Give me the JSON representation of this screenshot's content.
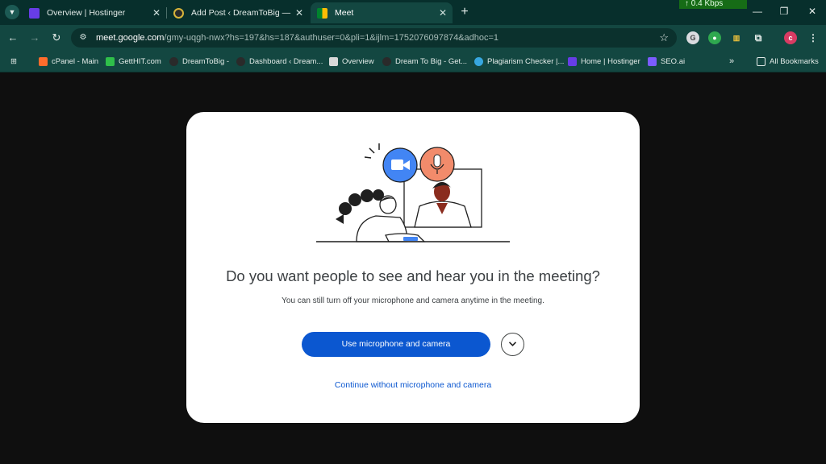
{
  "browser": {
    "tabs": [
      {
        "title": "Overview | Hostinger",
        "favicon": "hostinger-icon",
        "active": false
      },
      {
        "title": "Add Post ‹ DreamToBig — Wor",
        "favicon": "wordpress-icon",
        "active": false
      },
      {
        "title": "Meet",
        "favicon": "google-meet-icon",
        "active": true
      }
    ],
    "net_speed": "0.4 Kbps",
    "url": {
      "host": "meet.google.com",
      "path": "/gmy-uqgh-nwx?hs=197&hs=187&authuser=0&pli=1&ijlm=1752076097874&adhoc=1"
    },
    "profile_initial": "c",
    "bookmarks": [
      {
        "label": "cPanel - Main",
        "icon": "cpanel-icon",
        "color": "#ff6c2c"
      },
      {
        "label": "GettHIT.com",
        "icon": "getthit-icon",
        "color": "#2fbf4a"
      },
      {
        "label": "DreamToBig -",
        "icon": "dreamtobig-icon",
        "color": "#2a2a2a"
      },
      {
        "label": "Dashboard ‹ Dream...",
        "icon": "dreamtobig-icon",
        "color": "#2a2a2a"
      },
      {
        "label": "Overview",
        "icon": "overview-icon",
        "color": "#d8d8d8"
      },
      {
        "label": "Dream To Big - Get...",
        "icon": "dreamtobig-icon",
        "color": "#2a2a2a"
      },
      {
        "label": "Plagiarism Checker |...",
        "icon": "plagiarism-icon",
        "color": "#37a7e0"
      },
      {
        "label": "Home | Hostinger",
        "icon": "hostinger-icon",
        "color": "#673de6"
      },
      {
        "label": "SEO.ai",
        "icon": "seoai-icon",
        "color": "#7b5cff"
      }
    ],
    "all_bookmarks_label": "All Bookmarks",
    "colors": {
      "frame": "#072f2c",
      "toolbar": "#134741",
      "omnibox": "#0b312d"
    }
  },
  "dialog": {
    "question": "Do you want people to see and hear you in the meeting?",
    "subtext": "You can still turn off your microphone and camera anytime in the meeting.",
    "primary_button": "Use microphone and camera",
    "secondary_link": "Continue without microphone and camera",
    "colors": {
      "primary": "#0b57d0",
      "camera_bubble": "#4285f4",
      "mic_bubble": "#f28b6b"
    }
  }
}
